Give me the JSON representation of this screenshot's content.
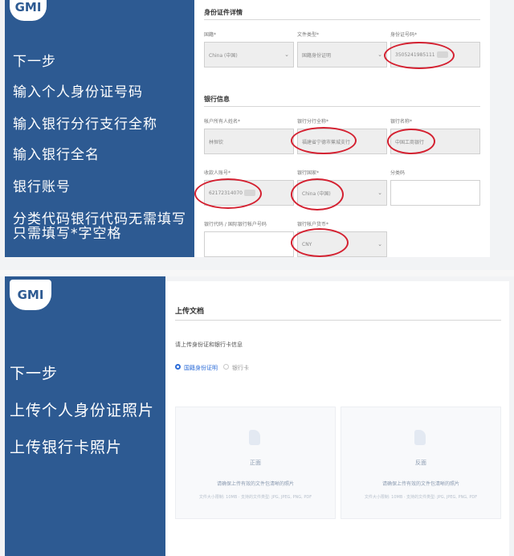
{
  "top": {
    "logo": "GMI",
    "steps": [
      "下一步",
      "输入个人身份证号码",
      "输入银行分行支行全称",
      "输入银行全名",
      "银行账号",
      "分类代码银行代码无需填写",
      "只需填写*字空格"
    ],
    "id_section": {
      "title": "身份证件详情",
      "fields": {
        "nationality": {
          "label": "国籍*",
          "value": "China (中国)"
        },
        "doc_type": {
          "label": "文件类型*",
          "value": "国籍身份证明"
        },
        "id_number": {
          "label": "身份证号码*",
          "value": "3505241985111"
        }
      }
    },
    "bank_section": {
      "title": "银行信息",
      "fields": {
        "holder_name": {
          "label": "帐户所有人姓名*",
          "value": "林恒钦"
        },
        "branch_name": {
          "label": "银行分行全称*",
          "value": "福建省宁德市蕉城支行"
        },
        "bank_name": {
          "label": "银行名称*",
          "value": "中国工商银行"
        },
        "account_number": {
          "label": "收款人账号*",
          "value": "62172314070"
        },
        "bank_country": {
          "label": "银行国家*",
          "value": "China (中国)"
        },
        "category_code": {
          "label": "分类码",
          "value": ""
        },
        "bank_code": {
          "label": "银行代码 / 国际银行帐户号码",
          "value": ""
        },
        "account_currency": {
          "label": "银行帐户货币*",
          "value": "CNY"
        }
      }
    }
  },
  "bottom": {
    "logo": "GMI",
    "steps": [
      "下一步",
      "上传个人身份证照片",
      "上传银行卡照片"
    ],
    "upload": {
      "title": "上传文档",
      "instruction": "请上传身份证和银行卡信息",
      "options": [
        "国籍身份证明",
        "银行卡"
      ],
      "boxes": [
        {
          "label": "正面",
          "hint": "请确保上传有效的文件包清晰的照片",
          "spec": "文件大小限制: 10MB · 支持的文件类型: JPG, JPEG, PNG, PDF"
        },
        {
          "label": "反面",
          "hint": "请确保上传有效的文件包清晰的照片",
          "spec": "文件大小限制: 10MB · 支持的文件类型: JPG, JPEG, PNG, PDF"
        }
      ]
    }
  },
  "colors": {
    "sidebar": "#2d5a92",
    "annotation": "#d42030",
    "radio_active": "#2d6dd8"
  },
  "icons": {
    "chevron": "chevron-down-icon",
    "upload": "upload-file-icon"
  }
}
